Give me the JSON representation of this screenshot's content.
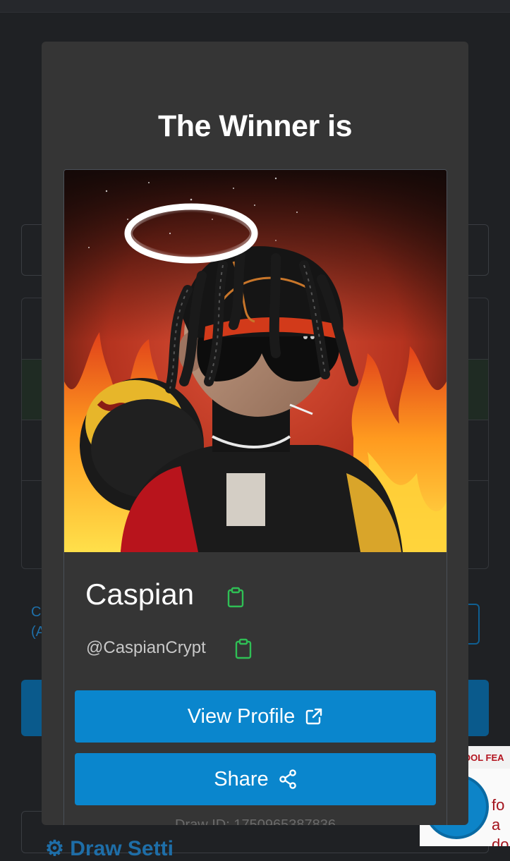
{
  "modal": {
    "title": "The Winner is",
    "winner": {
      "name": "Caspian",
      "handle": "@CaspianCrypt"
    },
    "view_profile_label": "View Profile",
    "share_label": "Share",
    "draw_id_text": "Draw ID: 1750965387836"
  },
  "background": {
    "left_text": "C\n(A",
    "bottom_title_text": "Draw Setti",
    "promo_strip_text": "OOL FEA",
    "promo_text": "fo\na do"
  },
  "icons": {
    "copy_name": "clipboard-icon",
    "copy_handle": "clipboard-icon",
    "view_profile": "external-link-icon",
    "share": "share-icon"
  },
  "colors": {
    "modal_bg": "#353535",
    "primary_button": "#0a86cd",
    "copy_icon": "#2fbf55",
    "page_bg": "#1f2124"
  }
}
